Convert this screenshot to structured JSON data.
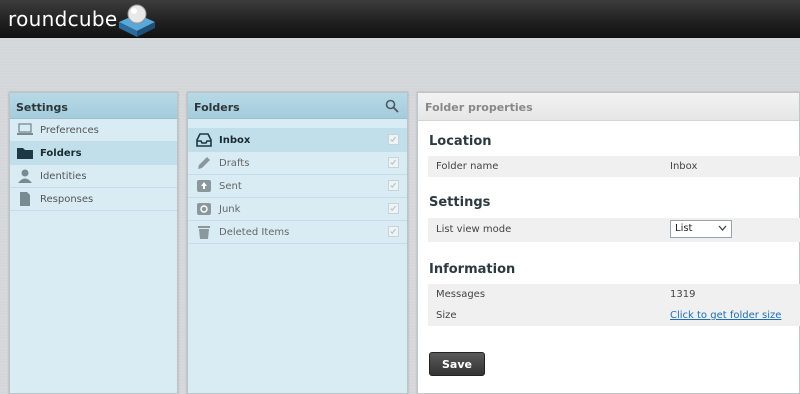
{
  "app": {
    "logo_text": "roundcube"
  },
  "settings_panel": {
    "title": "Settings",
    "items": [
      {
        "label": "Preferences",
        "icon": "computer-icon"
      },
      {
        "label": "Folders",
        "icon": "folder-icon",
        "selected": true
      },
      {
        "label": "Identities",
        "icon": "person-icon"
      },
      {
        "label": "Responses",
        "icon": "document-icon"
      }
    ]
  },
  "folders_panel": {
    "title": "Folders",
    "items": [
      {
        "label": "Inbox",
        "icon": "inbox-icon",
        "selected": true,
        "subscribed": true
      },
      {
        "label": "Drafts",
        "icon": "pencil-icon",
        "subscribed": true
      },
      {
        "label": "Sent",
        "icon": "sent-icon",
        "subscribed": true
      },
      {
        "label": "Junk",
        "icon": "junk-icon",
        "subscribed": true
      },
      {
        "label": "Deleted Items",
        "icon": "trash-icon",
        "subscribed": true
      }
    ]
  },
  "properties": {
    "title": "Folder properties",
    "location": {
      "heading": "Location",
      "folder_name_label": "Folder name",
      "folder_name_value": "Inbox"
    },
    "settings": {
      "heading": "Settings",
      "list_view_mode_label": "List view mode",
      "list_view_mode_value": "List"
    },
    "information": {
      "heading": "Information",
      "messages_label": "Messages",
      "messages_value": "1319",
      "size_label": "Size",
      "size_link": "Click to get folder size"
    },
    "save_label": "Save"
  },
  "colors": {
    "topbar": "#1f1f1f",
    "panel_bg": "#d9ecf4",
    "panel_header": "#a4ccdc",
    "selected_row": "#c1dfea",
    "link": "#1a6fb5",
    "button": "#333333"
  }
}
